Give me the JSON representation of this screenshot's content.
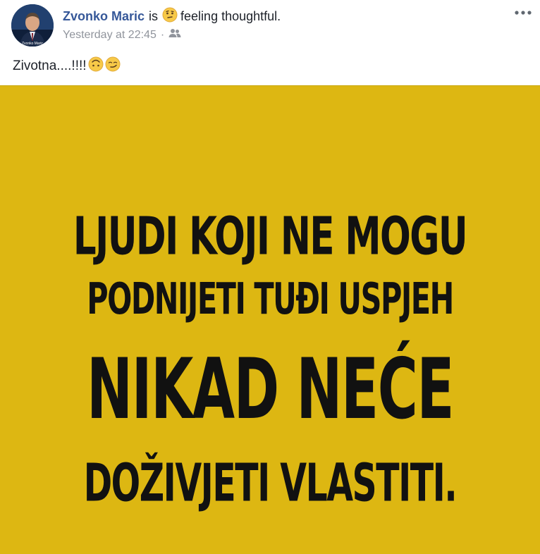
{
  "post": {
    "author": "Zvonko Maric",
    "is_word": "is",
    "feeling": "feeling thoughtful.",
    "feeling_icon": "thinking-face-icon",
    "timestamp": "Yesterday at 22:45",
    "separator": "·",
    "audience_icon": "friends-icon",
    "text": "Zivotna....!!!!",
    "text_emojis": [
      "upside-down-face-icon",
      "smirking-face-icon"
    ],
    "avatar_caption": "Zvonko Maric"
  },
  "image": {
    "background_color": "#ddb712",
    "lines": [
      "LJUDI KOJI NE MOGU",
      "PODNIJETI TUĐI USPJEH",
      "NIKAD NEĆE",
      "DOŽIVJETI VLASTITI."
    ]
  },
  "colors": {
    "author_link": "#365899",
    "meta_text": "#90949c",
    "body_text": "#1d2129"
  }
}
